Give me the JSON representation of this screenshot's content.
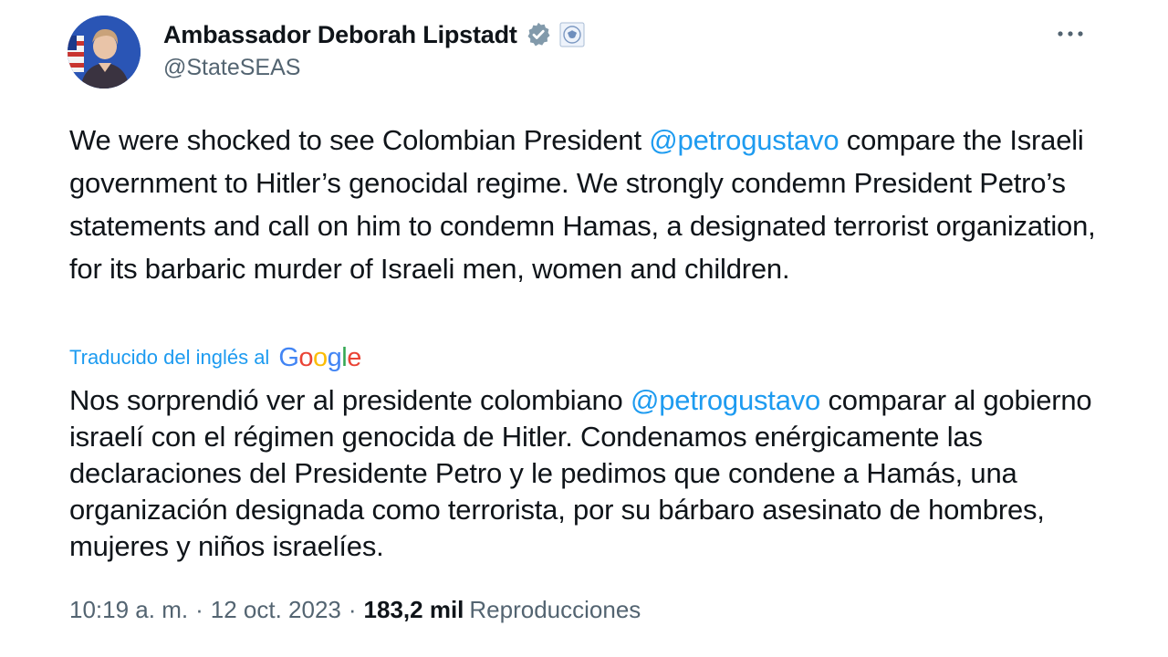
{
  "author": {
    "display_name": "Ambassador Deborah Lipstadt",
    "handle": "@StateSEAS",
    "avatar_icon": "profile-photo",
    "verified_icon": "verified-gray-badge-icon",
    "affiliation_icon": "state-department-seal-icon"
  },
  "menu": {
    "more_icon": "more-horizontal-icon"
  },
  "tweet": {
    "text_part1": "We were shocked to see Colombian President ",
    "mention": "@petrogustavo",
    "text_part2": " compare the Israeli government to Hitler’s genocidal regime. We strongly condemn President Petro’s statements and call on him to condemn Hamas, a designated terrorist organization, for its barbaric murder of Israeli men, women and children."
  },
  "translation": {
    "label": "Traducido del inglés al",
    "provider_letters": [
      "G",
      "o",
      "o",
      "g",
      "l",
      "e"
    ],
    "text_part1": "Nos sorprendió ver al presidente colombiano ",
    "mention": "@petrogustavo",
    "text_part2": " comparar al gobierno israelí con el régimen genocida de Hitler. Condenamos enérgicamente las declaraciones del Presidente Petro y le pedimos que condene a Hamás, una organización designada como terrorista, por su bárbaro asesinato de hombres, mujeres y niños israelíes."
  },
  "meta": {
    "time": "10:19 a. m.",
    "separator": "·",
    "date": "12 oct. 2023",
    "views_count": "183,2 mil",
    "views_label": "Reproducciones"
  },
  "colors": {
    "link": "#1d9bf0",
    "text": "#0f1419",
    "secondary": "#536471",
    "google_blue": "#4285f4",
    "google_red": "#ea4335",
    "google_yellow": "#fbbc05",
    "google_green": "#34a853"
  }
}
